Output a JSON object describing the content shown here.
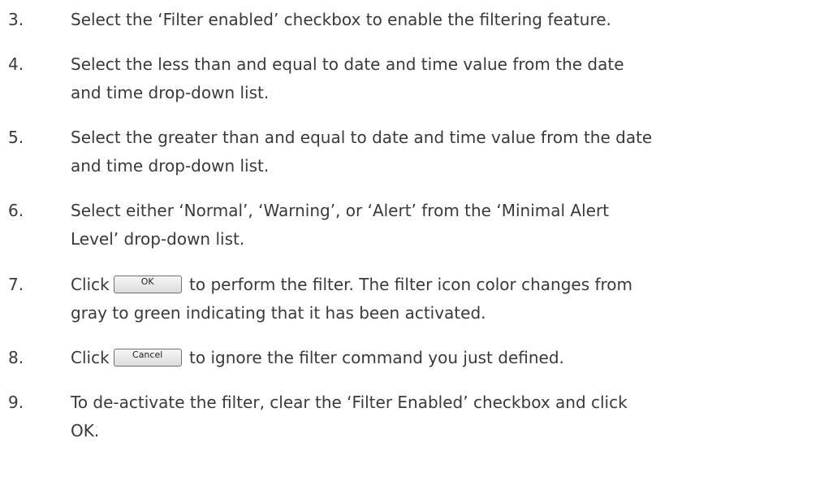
{
  "steps": [
    {
      "number": "3.",
      "text": "Select the ‘Filter enabled’ checkbox to enable the filtering feature."
    },
    {
      "number": "4.",
      "line1": "Select the less than and equal to date and time value from the date",
      "line2": "and time drop-down list."
    },
    {
      "number": "5.",
      "line1": "Select the greater than and equal to date and time value from the date",
      "line2": "and time drop-down list."
    },
    {
      "number": "6.",
      "line1": "Select either ‘Normal’, ‘Warning’, or ‘Alert’ from the ‘Minimal Alert",
      "line2": "Level’ drop-down list."
    },
    {
      "number": "7.",
      "prefix": "Click",
      "button_label": "OK",
      "suffix": "to perform the filter. The filter icon color changes from",
      "line2": "gray to green indicating that it has been activated."
    },
    {
      "number": "8.",
      "prefix": "Click",
      "button_label": "Cancel",
      "suffix": "to ignore the filter command you just defined."
    },
    {
      "number": "9.",
      "line1": "To de-activate the filter, clear the ‘Filter Enabled’ checkbox and click",
      "line2": "OK."
    }
  ]
}
